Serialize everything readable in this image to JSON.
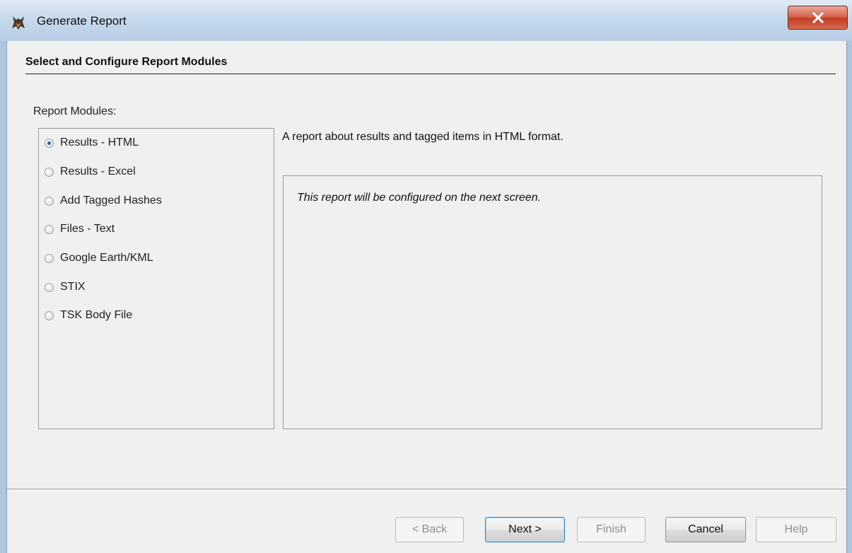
{
  "window": {
    "title": "Generate Report"
  },
  "header": {
    "heading": "Select and Configure Report Modules"
  },
  "modules": {
    "label": "Report Modules:",
    "selected_index": 0,
    "items": [
      {
        "label": "Results - HTML",
        "checked": true
      },
      {
        "label": "Results - Excel",
        "checked": false
      },
      {
        "label": "Add Tagged Hashes",
        "checked": false
      },
      {
        "label": "Files - Text",
        "checked": false
      },
      {
        "label": "Google Earth/KML",
        "checked": false
      },
      {
        "label": "STIX",
        "checked": false
      },
      {
        "label": "TSK Body File",
        "checked": false
      }
    ]
  },
  "detail": {
    "description": "A report about results and tagged items in HTML format.",
    "config_note": "This report will be configured on the next screen."
  },
  "buttons": {
    "back": "< Back",
    "next": "Next >",
    "finish": "Finish",
    "cancel": "Cancel",
    "help": "Help"
  },
  "colors": {
    "close_button": "#c23b22",
    "radio_selected": "#2f5f9e"
  }
}
